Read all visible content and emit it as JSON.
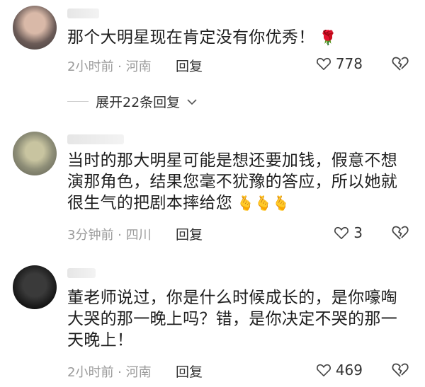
{
  "comments": [
    {
      "text": "那个大明星现在肯定没有你优秀！",
      "emoji": "🌹",
      "meta": "2小时前 · 河南",
      "reply_label": "回复",
      "likes": "778",
      "expand_label": "展开22条回复"
    },
    {
      "text_lines": [
        "当时的那大明星可能是想还要加钱，假意不想",
        "演那角色，结果您毫不犹豫的答应，所以她就",
        "很生气的把剧本摔给您"
      ],
      "emoji": "🫰🫰🫰",
      "meta": "3分钟前 · 四川",
      "reply_label": "回复",
      "likes": "3"
    },
    {
      "text_lines": [
        "董老师说过，你是什么时候成长的，是你嚎啕",
        "大哭的那一晚上吗？错，是你决定不哭的那一",
        "天晚上！"
      ],
      "meta": "2小时前 · 河南",
      "reply_label": "回复",
      "likes": "469"
    }
  ],
  "icons": {
    "like": "heart-outline-icon",
    "dislike": "broken-heart-icon",
    "expand": "chevron-down-icon"
  },
  "colors": {
    "text": "#1e1e1e",
    "meta": "#9a9a9a",
    "rose": "#e98e9e"
  }
}
